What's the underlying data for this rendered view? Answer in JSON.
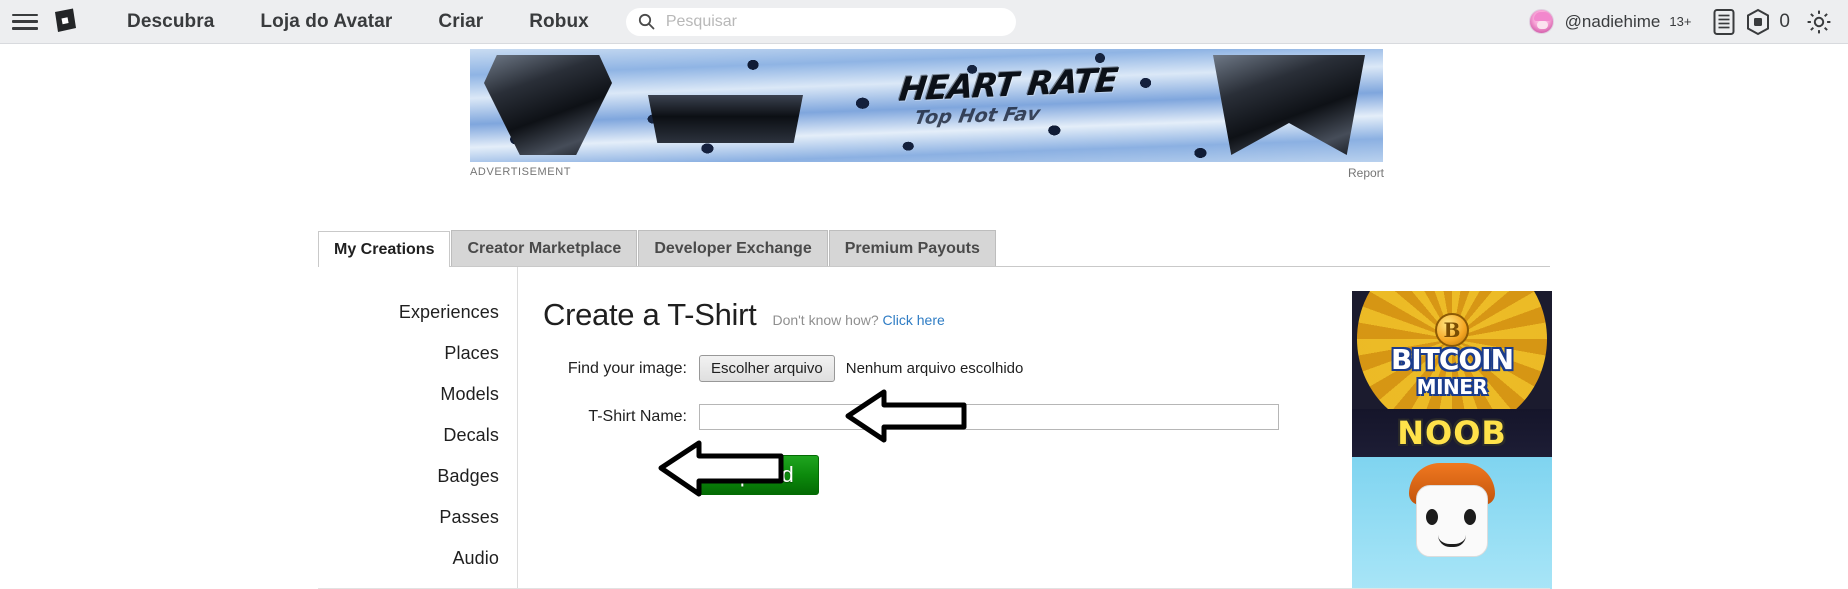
{
  "nav": {
    "menu_icon": "hamburger-menu-icon",
    "logo_icon": "roblox-logo-icon",
    "links": [
      {
        "label": "Descubra"
      },
      {
        "label": "Loja do Avatar"
      },
      {
        "label": "Criar"
      },
      {
        "label": "Robux"
      }
    ],
    "search": {
      "placeholder": "Pesquisar",
      "value": "",
      "icon": "search-icon"
    },
    "user": {
      "avatar": "user-avatar",
      "username": "@nadiehime",
      "age_badge": "13+"
    },
    "icons": {
      "notifications": "list-document-icon",
      "robux": "robux-icon",
      "settings": "gear-icon"
    },
    "robux_amount": "0"
  },
  "ad": {
    "title": "HEART RATE",
    "subtitle": "Top Hot Fav",
    "label": "ADVERTISEMENT",
    "report": "Report"
  },
  "tabs": [
    {
      "label": "My Creations",
      "active": true
    },
    {
      "label": "Creator Marketplace",
      "active": false
    },
    {
      "label": "Developer Exchange",
      "active": false
    },
    {
      "label": "Premium Payouts",
      "active": false
    }
  ],
  "sidebar": {
    "items": [
      {
        "label": "Experiences"
      },
      {
        "label": "Places"
      },
      {
        "label": "Models"
      },
      {
        "label": "Decals"
      },
      {
        "label": "Badges"
      },
      {
        "label": "Passes"
      },
      {
        "label": "Audio"
      }
    ]
  },
  "main": {
    "title": "Create a T-Shirt",
    "hint": "Don't know how?",
    "hint_link": "Click here",
    "form": {
      "image_label": "Find your image:",
      "file_button": "Escolher arquivo",
      "file_name": "Nenhum arquivo escolhido",
      "name_label": "T-Shirt Name:",
      "name_value": "",
      "name_placeholder": "",
      "upload_button": "Upload"
    }
  },
  "right_ad": {
    "coin_symbol": "B",
    "title": "BITCOIN",
    "subtitle": "MINER",
    "tagline": "NOOB"
  },
  "colors": {
    "nav_bg": "#edeef0",
    "accent_link": "#2e7cc4",
    "upload_green": "#0c8a0c",
    "tab_inactive": "#d6d6d6"
  }
}
